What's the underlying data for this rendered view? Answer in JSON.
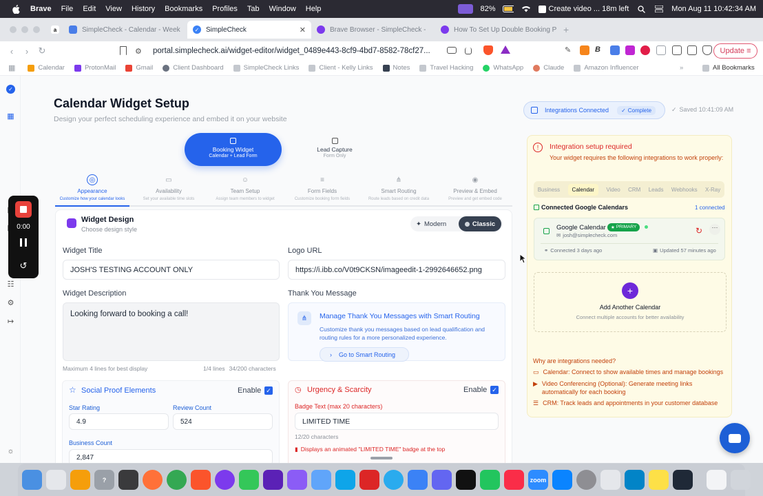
{
  "menubar": {
    "app": "Brave",
    "items": [
      "File",
      "Edit",
      "View",
      "History",
      "Bookmarks",
      "Profiles",
      "Tab",
      "Window",
      "Help"
    ],
    "battery": "82%",
    "reminder": "Create video ... 18m left",
    "datetime": "Mon Aug 11  10:42:34 AM"
  },
  "tabs": [
    {
      "title": "SimpleCheck - Calendar - Week",
      "favicon": "calendar-icon",
      "color": "#4a7ee8"
    },
    {
      "title": "SimpleCheck",
      "favicon": "check-icon",
      "color": "#3b82f6",
      "active": true
    },
    {
      "title": "Brave Browser - SimpleCheck - ",
      "favicon": "gear-icon",
      "color": "#7c3aed"
    },
    {
      "title": "How To Set Up Double Booking P",
      "favicon": "gear-icon",
      "color": "#7c3aed"
    }
  ],
  "address": {
    "url": "portal.simplecheck.ai/widget-editor/widget_0489e443-8cf9-4bd7-8582-78cf27...",
    "update_label": "Update"
  },
  "bookmarks": [
    {
      "label": "Calendar",
      "color": "#f59e0b"
    },
    {
      "label": "ProtonMail",
      "color": "#7c3aed"
    },
    {
      "label": "Gmail",
      "color": "#ea4335"
    },
    {
      "label": "Client Dashboard",
      "color": "#6b7280"
    },
    {
      "label": "SimpleCheck Links",
      "color": "#9aa0a8"
    },
    {
      "label": "Client - Kelly Links",
      "color": "#9aa0a8"
    },
    {
      "label": "Notes",
      "color": "#374151"
    },
    {
      "label": "Travel Hacking",
      "color": "#9aa0a8"
    },
    {
      "label": "WhatsApp",
      "color": "#25d366"
    },
    {
      "label": "Claude",
      "color": "#e07a5f"
    },
    {
      "label": "Amazon Influencer",
      "color": "#9aa0a8"
    }
  ],
  "all_bookmarks": "All Bookmarks",
  "recorder": {
    "time": "0:00"
  },
  "header": {
    "title": "Calendar Widget Setup",
    "subtitle": "Design your perfect scheduling experience and embed it on your website"
  },
  "status": {
    "integrations": "Integrations Connected",
    "complete": "Complete",
    "saved": "Saved 10:41:09 AM"
  },
  "modes": [
    {
      "title": "Booking Widget",
      "sub": "Calendar + Lead Form",
      "active": true
    },
    {
      "title": "Lead Capture",
      "sub": "Form Only"
    }
  ],
  "steps": [
    {
      "title": "Appearance",
      "sub": "Customize how your calendar looks",
      "active": true
    },
    {
      "title": "Availability",
      "sub": "Set your available time slots"
    },
    {
      "title": "Team Setup",
      "sub": "Assign team members to widget"
    },
    {
      "title": "Form Fields",
      "sub": "Customize booking form fields"
    },
    {
      "title": "Smart Routing",
      "sub": "Route leads based on credit data"
    },
    {
      "title": "Preview & Embed",
      "sub": "Preview and get embed code"
    }
  ],
  "design": {
    "title": "Widget Design",
    "sub": "Choose design style",
    "modern": "Modern",
    "classic": "Classic"
  },
  "form": {
    "widget_title_label": "Widget Title",
    "widget_title_value": "JOSH'S TESTING ACCOUNT ONLY",
    "logo_url_label": "Logo URL",
    "logo_url_value": "https://i.ibb.co/V0t9CKSN/imageedit-1-2992646652.png",
    "description_label": "Widget Description",
    "description_value": "Looking forward to booking a call!",
    "description_hint": "Maximum 4 lines for best display",
    "description_lines": "1/4 lines",
    "description_chars": "34/200 characters",
    "thankyou_label": "Thank You Message",
    "routing_title": "Manage Thank You Messages with Smart Routing",
    "routing_desc": "Customize thank you messages based on lead qualification and routing rules for a more personalized experience.",
    "routing_button": "Go to Smart Routing"
  },
  "social": {
    "title": "Social Proof Elements",
    "enable": "Enable",
    "star_label": "Star Rating",
    "star_value": "4.9",
    "review_label": "Review Count",
    "review_value": "524",
    "business_label": "Business Count",
    "business_value": "2,847"
  },
  "urgency": {
    "title": "Urgency & Scarcity",
    "enable": "Enable",
    "badge_label": "Badge Text (max 20 characters)",
    "badge_value": "LIMITED TIME",
    "badge_count": "12/20 characters",
    "badge_note": "Displays an animated \"LIMITED TIME\" badge at the top"
  },
  "integrations": {
    "title": "Integration setup required",
    "desc": "Your widget requires the following integrations to work properly:",
    "tabs": [
      "Business",
      "Calendar",
      "Video",
      "CRM",
      "Leads",
      "Webhooks",
      "X-Ray"
    ],
    "active_tab": "Calendar",
    "connected_title": "Connected Google Calendars",
    "connected_count": "1 connected",
    "cal_name": "Google Calendar",
    "cal_badge": "PRIMARY",
    "cal_email": "josh@simplecheck.com",
    "cal_connected": "Connected 3 days ago",
    "cal_updated": "Updated 57 minutes ago",
    "add_title": "Add Another Calendar",
    "add_sub": "Connect multiple accounts for better availability",
    "why": "Why are integrations needed?",
    "reasons": [
      "Calendar: Connect to show available times and manage bookings",
      "Video Conferencing (Optional): Generate meeting links automatically for each booking",
      "CRM: Track leads and appointments in your customer database"
    ]
  },
  "colors": {
    "accent": "#2563eb",
    "warning_bg": "#fefbe6",
    "error": "#dc2626"
  }
}
